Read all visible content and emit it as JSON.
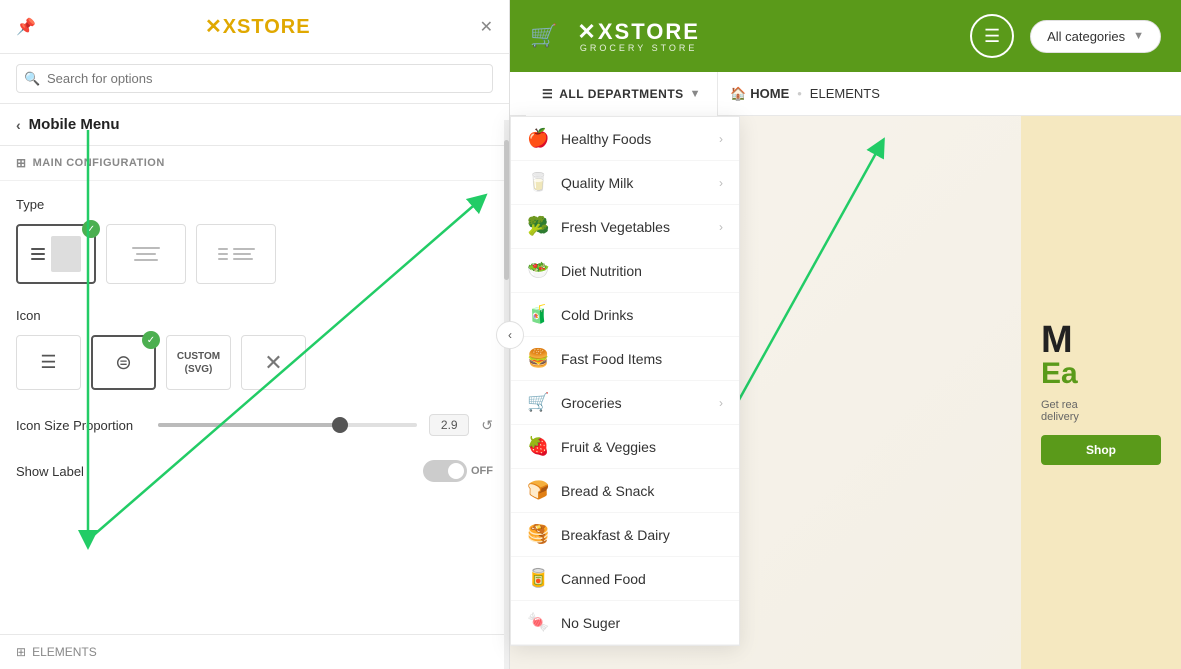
{
  "leftPanel": {
    "logo": "XSTORE",
    "searchPlaceholder": "Search for options",
    "backLabel": "Mobile Menu",
    "sectionTitle": "MAIN CONFIGURATION",
    "typeLabel": "Type",
    "iconLabel": "Icon",
    "iconOptions": [
      {
        "id": "hamburger",
        "symbol": "☰",
        "selected": false
      },
      {
        "id": "circle-menu",
        "symbol": "⊜",
        "selected": true
      },
      {
        "id": "custom-svg",
        "symbol": "CUSTOM\n(SVG)",
        "selected": false
      },
      {
        "id": "close",
        "symbol": "✕",
        "selected": false
      }
    ],
    "sliderLabel": "Icon Size Proportion",
    "sliderValue": "2.9",
    "showLabelLabel": "Show Label",
    "showLabelState": "OFF",
    "footerLabel": "ELEMENTS"
  },
  "rightPanel": {
    "header": {
      "logoText": "XSTORE",
      "logoSub": "GROCERY STORE",
      "menuLabel": "☰",
      "categoriesLabel": "All categories"
    },
    "navbar": {
      "departmentsLabel": "ALL DEPARTMENTS",
      "homeLabel": "HOME",
      "elementsLabel": "ELEMENTS"
    },
    "menu": {
      "items": [
        {
          "icon": "🍎",
          "label": "Healthy Foods",
          "hasArrow": true
        },
        {
          "icon": "🥛",
          "label": "Quality Milk",
          "hasArrow": true
        },
        {
          "icon": "🥦",
          "label": "Fresh Vegetables",
          "hasArrow": true
        },
        {
          "icon": "🥗",
          "label": "Diet Nutrition",
          "hasArrow": false
        },
        {
          "icon": "🧃",
          "label": "Cold Drinks",
          "hasArrow": false
        },
        {
          "icon": "🍔",
          "label": "Fast Food Items",
          "hasArrow": false
        },
        {
          "icon": "🛒",
          "label": "Groceries",
          "hasArrow": true
        },
        {
          "icon": "🍓",
          "label": "Fruit & Veggies",
          "hasArrow": false
        },
        {
          "icon": "🍞",
          "label": "Bread & Snack",
          "hasArrow": false
        },
        {
          "icon": "🥞",
          "label": "Breakfast & Dairy",
          "hasArrow": false
        },
        {
          "icon": "🥫",
          "label": "Canned Food",
          "hasArrow": false
        },
        {
          "icon": "🍬",
          "label": "No Suger",
          "hasArrow": false
        }
      ]
    },
    "hero": {
      "title": "M",
      "subtitle": "Ea",
      "desc": "Get rea\ndelivery",
      "shopBtn": "Shop"
    }
  }
}
